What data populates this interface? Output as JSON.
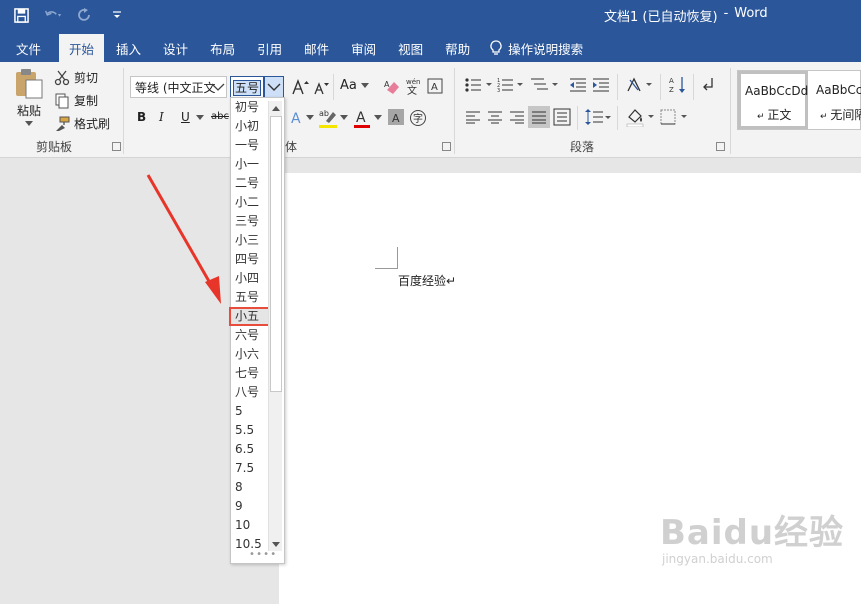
{
  "titlebar": {
    "title": "文档1 (已自动恢复)",
    "separator": "-",
    "app": "Word"
  },
  "tabs": [
    "文件",
    "开始",
    "插入",
    "设计",
    "布局",
    "引用",
    "邮件",
    "审阅",
    "视图",
    "帮助"
  ],
  "tab_search": "操作说明搜索",
  "clipboard": {
    "paste": "粘贴",
    "cut": "剪切",
    "copy": "复制",
    "format_painter": "格式刷",
    "group_label": "剪贴板"
  },
  "font": {
    "font_name": "等线 (中文正文",
    "font_size": "五号",
    "group_label_partial": "体",
    "change_case": "Aa",
    "bold": "B",
    "italic": "I",
    "underline": "U",
    "strike": "abc",
    "color_a": "A"
  },
  "paragraph": {
    "group_label": "段落"
  },
  "styles": {
    "sample1": "AaBbCcDd",
    "name1": "正文",
    "sample2": "AaBbCc",
    "name2": "无间隔"
  },
  "document": {
    "text": "百度经验↵"
  },
  "font_size_options": [
    "初号",
    "小初",
    "一号",
    "小一",
    "二号",
    "小二",
    "三号",
    "小三",
    "四号",
    "小四",
    "五号",
    "小五",
    "六号",
    "小六",
    "七号",
    "八号",
    "5",
    "5.5",
    "6.5",
    "7.5",
    "8",
    "9",
    "10",
    "10.5"
  ],
  "highlighted_option": "小五",
  "watermark": {
    "logo": "Baidu经验",
    "url": "jingyan.baidu.com"
  },
  "colors": {
    "brand": "#2b579a",
    "highlight_box": "#e74c3c",
    "arrow": "#e8352a"
  }
}
